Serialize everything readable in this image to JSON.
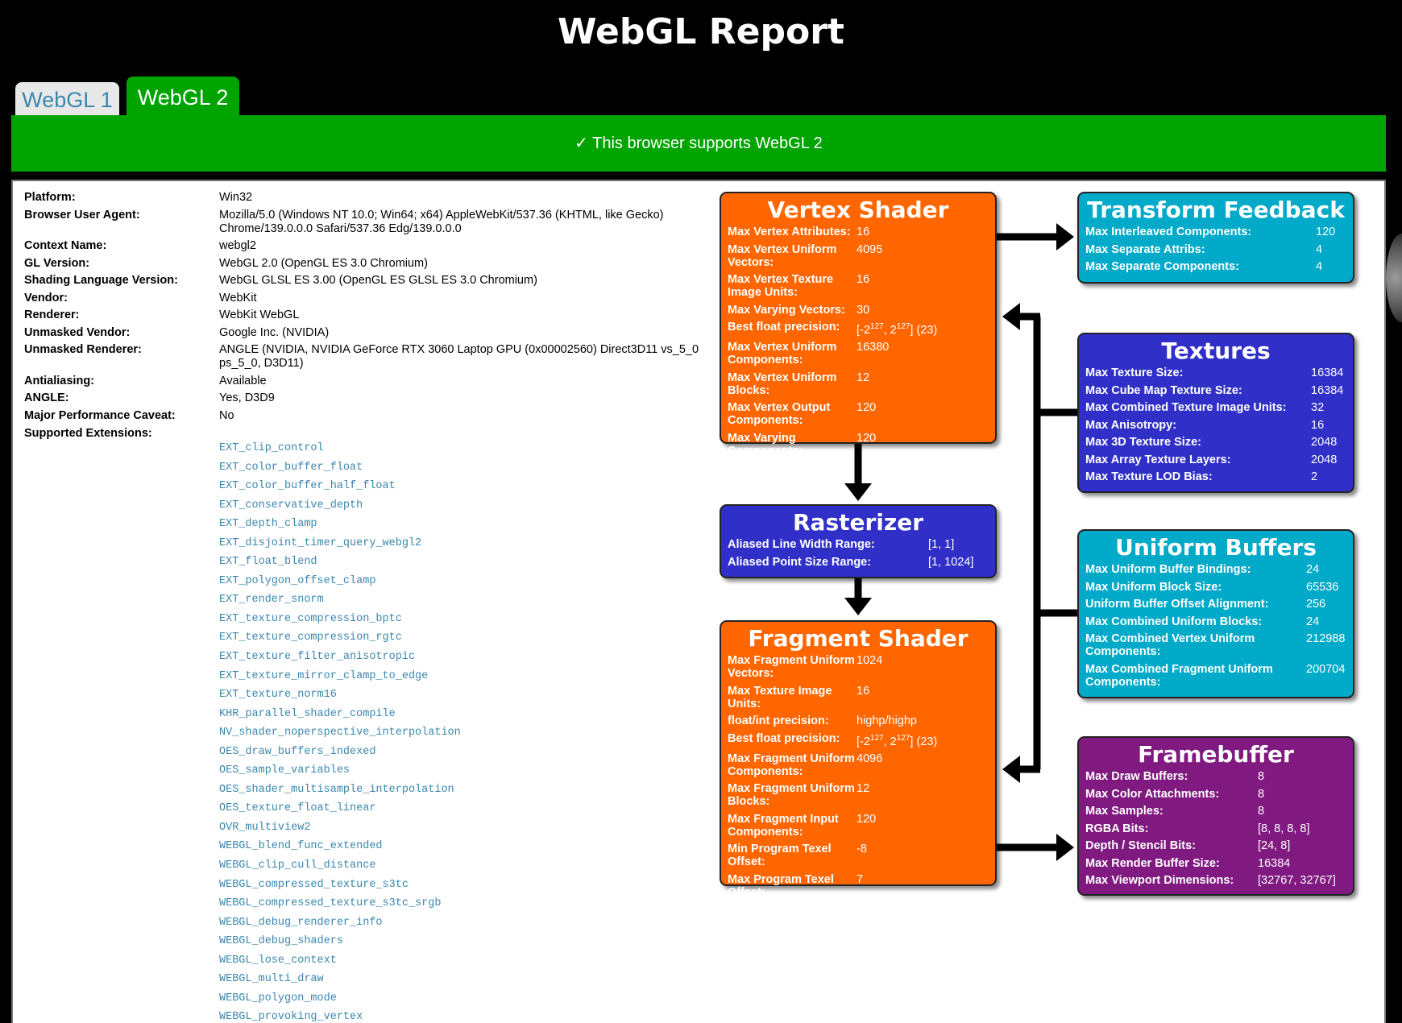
{
  "title": "WebGL Report",
  "tabs": [
    {
      "label": "WebGL 1"
    },
    {
      "label": "WebGL 2"
    }
  ],
  "banner": "✓ This browser supports WebGL 2",
  "info": [
    {
      "k": "Platform:",
      "v": "Win32"
    },
    {
      "k": "Browser User Agent:",
      "v": "Mozilla/5.0 (Windows NT 10.0; Win64; x64) AppleWebKit/537.36 (KHTML, like Gecko) Chrome/139.0.0.0 Safari/537.36 Edg/139.0.0.0"
    },
    {
      "k": "Context Name:",
      "v": "webgl2"
    },
    {
      "k": "GL Version:",
      "v": "WebGL 2.0 (OpenGL ES 3.0 Chromium)"
    },
    {
      "k": "Shading Language Version:",
      "v": "WebGL GLSL ES 3.00 (OpenGL ES GLSL ES 3.0 Chromium)"
    },
    {
      "k": "Vendor:",
      "v": "WebKit"
    },
    {
      "k": "Renderer:",
      "v": "WebKit WebGL"
    },
    {
      "k": "Unmasked Vendor:",
      "v": "Google Inc. (NVIDIA)"
    },
    {
      "k": "Unmasked Renderer:",
      "v": "ANGLE (NVIDIA, NVIDIA GeForce RTX 3060 Laptop GPU (0x00002560) Direct3D11 vs_5_0 ps_5_0, D3D11)"
    },
    {
      "k": "Antialiasing:",
      "v": "Available"
    },
    {
      "k": "ANGLE:",
      "v": "Yes, D3D9"
    },
    {
      "k": "Major Performance Caveat:",
      "v": "No"
    },
    {
      "k": "Supported Extensions:",
      "v": ""
    }
  ],
  "extensions": [
    "EXT_clip_control",
    "EXT_color_buffer_float",
    "EXT_color_buffer_half_float",
    "EXT_conservative_depth",
    "EXT_depth_clamp",
    "EXT_disjoint_timer_query_webgl2",
    "EXT_float_blend",
    "EXT_polygon_offset_clamp",
    "EXT_render_snorm",
    "EXT_texture_compression_bptc",
    "EXT_texture_compression_rgtc",
    "EXT_texture_filter_anisotropic",
    "EXT_texture_mirror_clamp_to_edge",
    "EXT_texture_norm16",
    "KHR_parallel_shader_compile",
    "NV_shader_noperspective_interpolation",
    "OES_draw_buffers_indexed",
    "OES_sample_variables",
    "OES_shader_multisample_interpolation",
    "OES_texture_float_linear",
    "OVR_multiview2",
    "WEBGL_blend_func_extended",
    "WEBGL_clip_cull_distance",
    "WEBGL_compressed_texture_s3tc",
    "WEBGL_compressed_texture_s3tc_srgb",
    "WEBGL_debug_renderer_info",
    "WEBGL_debug_shaders",
    "WEBGL_lose_context",
    "WEBGL_multi_draw",
    "WEBGL_polygon_mode",
    "WEBGL_provoking_vertex"
  ],
  "vertex": {
    "title": "Vertex Shader",
    "rows": [
      {
        "k": "Max Vertex Attributes:",
        "v": "16"
      },
      {
        "k": "Max Vertex Uniform Vectors:",
        "v": "4095"
      },
      {
        "k": "Max Vertex Texture Image Units:",
        "v": "16"
      },
      {
        "k": "Max Varying Vectors:",
        "v": "30"
      },
      {
        "k": "Best float precision:",
        "v": "[-2^127, 2^127] (23)"
      },
      {
        "k": "Max Vertex Uniform Components:",
        "v": "16380"
      },
      {
        "k": "Max Vertex Uniform Blocks:",
        "v": "12"
      },
      {
        "k": "Max Vertex Output Components:",
        "v": "120"
      },
      {
        "k": "Max Varying Components:",
        "v": "120"
      }
    ]
  },
  "rasterizer": {
    "title": "Rasterizer",
    "rows": [
      {
        "k": "Aliased Line Width Range:",
        "v": "[1, 1]"
      },
      {
        "k": "Aliased Point Size Range:",
        "v": "[1, 1024]"
      }
    ]
  },
  "fragment": {
    "title": "Fragment Shader",
    "rows": [
      {
        "k": "Max Fragment Uniform Vectors:",
        "v": "1024"
      },
      {
        "k": "Max Texture Image Units:",
        "v": "16"
      },
      {
        "k": "float/int precision:",
        "v": "highp/highp"
      },
      {
        "k": "Best float precision:",
        "v": "[-2^127, 2^127] (23)"
      },
      {
        "k": "Max Fragment Uniform Components:",
        "v": "4096"
      },
      {
        "k": "Max Fragment Uniform Blocks:",
        "v": "12"
      },
      {
        "k": "Max Fragment Input Components:",
        "v": "120"
      },
      {
        "k": "Min Program Texel Offset:",
        "v": "-8"
      },
      {
        "k": "Max Program Texel Offset:",
        "v": "7"
      }
    ]
  },
  "transform": {
    "title": "Transform Feedback",
    "rows": [
      {
        "k": "Max Interleaved Components:",
        "v": "120"
      },
      {
        "k": "Max Separate Attribs:",
        "v": "4"
      },
      {
        "k": "Max Separate Components:",
        "v": "4"
      }
    ]
  },
  "textures": {
    "title": "Textures",
    "rows": [
      {
        "k": "Max Texture Size:",
        "v": "16384"
      },
      {
        "k": "Max Cube Map Texture Size:",
        "v": "16384"
      },
      {
        "k": "Max Combined Texture Image Units:",
        "v": "32"
      },
      {
        "k": "Max Anisotropy:",
        "v": "16"
      },
      {
        "k": "Max 3D Texture Size:",
        "v": "2048"
      },
      {
        "k": "Max Array Texture Layers:",
        "v": "2048"
      },
      {
        "k": "Max Texture LOD Bias:",
        "v": "2"
      }
    ]
  },
  "uniform": {
    "title": "Uniform Buffers",
    "rows": [
      {
        "k": "Max Uniform Buffer Bindings:",
        "v": "24"
      },
      {
        "k": "Max Uniform Block Size:",
        "v": "65536"
      },
      {
        "k": "Uniform Buffer Offset Alignment:",
        "v": "256"
      },
      {
        "k": "Max Combined Uniform Blocks:",
        "v": "24"
      },
      {
        "k": "Max Combined Vertex Uniform Components:",
        "v": "212988"
      },
      {
        "k": "Max Combined Fragment Uniform Components:",
        "v": "200704"
      }
    ]
  },
  "framebuffer": {
    "title": "Framebuffer",
    "rows": [
      {
        "k": "Max Draw Buffers:",
        "v": "8"
      },
      {
        "k": "Max Color Attachments:",
        "v": "8"
      },
      {
        "k": "Max Samples:",
        "v": "8"
      },
      {
        "k": "RGBA Bits:",
        "v": "[8, 8, 8, 8]"
      },
      {
        "k": "Depth / Stencil Bits:",
        "v": "[24, 8]"
      },
      {
        "k": "Max Render Buffer Size:",
        "v": "16384"
      },
      {
        "k": "Max Viewport Dimensions:",
        "v": "[32767, 32767]"
      }
    ]
  },
  "colors": {
    "green": "#00a400",
    "orange": "#ff6600",
    "blue": "#3030c8",
    "cyan": "#00aac8",
    "purple": "#801a80",
    "link": "#3a87ad"
  }
}
